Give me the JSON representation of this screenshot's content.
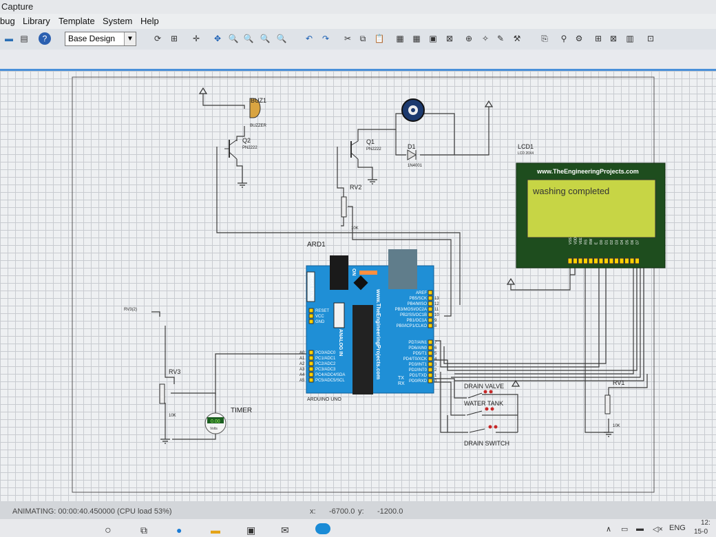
{
  "window": {
    "title": "Capture"
  },
  "menu": [
    "bug",
    "Library",
    "Template",
    "System",
    "Help"
  ],
  "toolbar": {
    "design_select": "Base Design"
  },
  "components": {
    "buzzer": {
      "ref": "BUZ1",
      "type": "BUZZER"
    },
    "q2": {
      "ref": "Q2",
      "type": "PN2222"
    },
    "q1": {
      "ref": "Q1",
      "type": "PN2222"
    },
    "d1": {
      "ref": "D1",
      "type": "1N4001"
    },
    "rv2": {
      "ref": "RV2",
      "value": "10K"
    },
    "rv3": {
      "ref": "RV3",
      "value": "10K",
      "wiper": "RV3(2)"
    },
    "rv1": {
      "ref": "RV1",
      "value": "10K"
    },
    "timer": {
      "label": "TIMER",
      "reading": "0.00",
      "unit": "Volts"
    },
    "arduino": {
      "ref": "ARD1",
      "name": "ARDUINO UNO",
      "url": "www.TheEngineeringProjects.com",
      "analog_label": "ANALOG IN",
      "reset_label": "Reset BTN",
      "on_label": "ON",
      "left_pins": [
        "RESET",
        "VCC",
        "GND"
      ],
      "analog_pins": [
        "PC0/ADC0",
        "PC1/ADC1",
        "PC2/ADC2",
        "PC3/ADC3",
        "PC4/ADC4/SDA",
        "PC5/ADC5/SCL"
      ],
      "analog_nums": [
        "A0",
        "A1",
        "A2",
        "A3",
        "A4",
        "A5"
      ],
      "right_pins_top": [
        "AREF",
        "PB5/SCK",
        "PB4/MISO",
        "PB3/MOSI/OC2A",
        "PB2/SS/OC1B",
        "PB1/OC1A",
        "PB0/ICP1/CLKO"
      ],
      "right_nums_top": [
        "",
        "13",
        "12",
        "11",
        "10",
        "9",
        "8"
      ],
      "right_pins_bottom": [
        "PD7/AIN1",
        "PD6/AIN0",
        "PD5/T1",
        "PD4/T0/XCK",
        "PD3/INT1",
        "PD2/INT0",
        "PD1/TXD",
        "PD0/RXD"
      ],
      "right_nums_bottom": [
        "7",
        "6",
        "5",
        "4",
        "3",
        "2",
        "1",
        "0"
      ],
      "tx": "TX",
      "rx": "RX"
    },
    "lcd": {
      "ref": "LCD1",
      "type": "LCD 20X4",
      "url": "www.TheEngineeringProjects.com",
      "text": "washing completed",
      "pins": [
        "VSS",
        "VDD",
        "VEE",
        "RS",
        "RW",
        "E",
        "D0",
        "D1",
        "D2",
        "D3",
        "D4",
        "D5",
        "D6",
        "D7"
      ]
    },
    "switches": [
      "DRAIN VALVE",
      "WATER TANK",
      "DRAIN SWITCH"
    ]
  },
  "status": {
    "animating": "ANIMATING: 00:00:40.450000 (CPU load 53%)",
    "x_label": "x:",
    "x": "-6700.0",
    "y_label": "y:",
    "y": "-1200.0"
  },
  "tray": {
    "lang": "ENG",
    "time": "12:",
    "date": "15-0"
  },
  "colors": {
    "lcd_bg": "#c7d545",
    "arduino": "#1f8fd6",
    "grid": "#c8cbd0",
    "wire": "#3a3a3a"
  }
}
